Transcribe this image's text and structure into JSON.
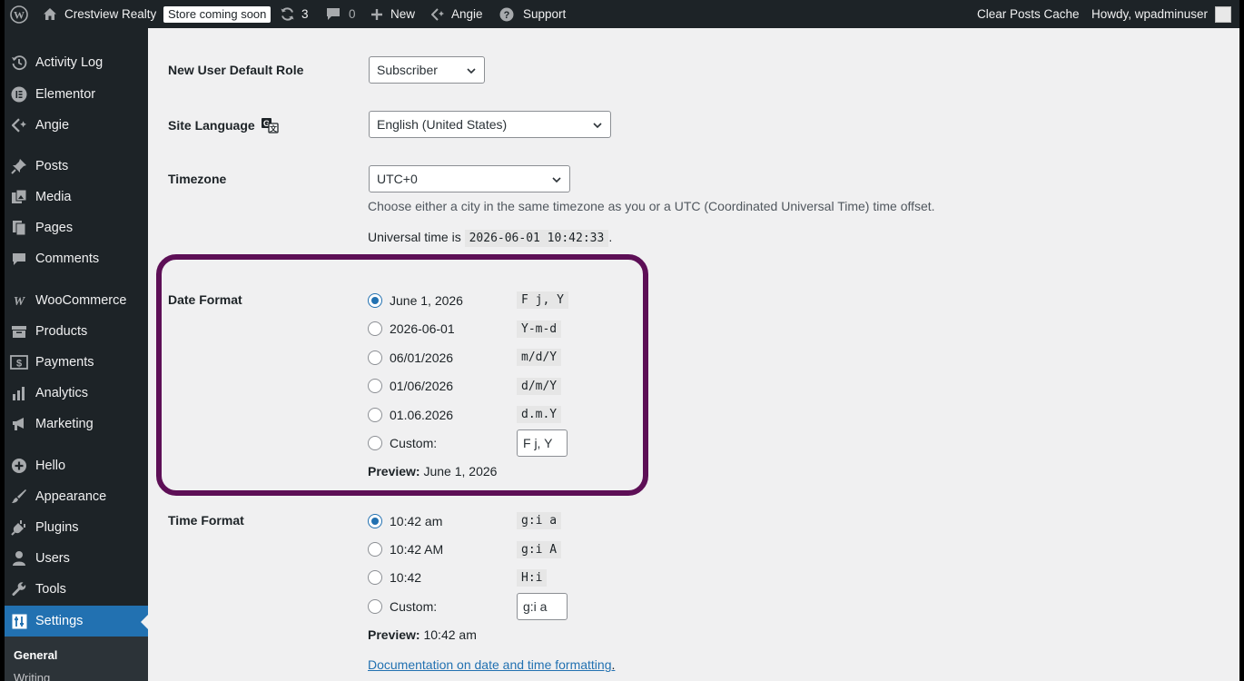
{
  "admin_bar": {
    "site_name": "Crestview Realty",
    "store_badge": "Store coming soon",
    "updates_count": "3",
    "comments_count": "0",
    "new_label": "New",
    "angie_label": "Angie",
    "support_label": "Support",
    "clear_cache": "Clear Posts Cache",
    "howdy": "Howdy, wpadminuser"
  },
  "sidebar": {
    "items": [
      {
        "label": "Activity Log",
        "icon": "history-icon"
      },
      {
        "label": "Elementor",
        "icon": "elementor-icon"
      },
      {
        "label": "Angie",
        "icon": "angie-icon"
      },
      {
        "label": "Posts",
        "icon": "pin-icon"
      },
      {
        "label": "Media",
        "icon": "media-icon"
      },
      {
        "label": "Pages",
        "icon": "pages-icon"
      },
      {
        "label": "Comments",
        "icon": "comment-icon"
      },
      {
        "label": "WooCommerce",
        "icon": "woo-icon"
      },
      {
        "label": "Products",
        "icon": "products-icon"
      },
      {
        "label": "Payments",
        "icon": "payments-icon"
      },
      {
        "label": "Analytics",
        "icon": "analytics-icon"
      },
      {
        "label": "Marketing",
        "icon": "megaphone-icon"
      },
      {
        "label": "Hello",
        "icon": "plus-circle-icon"
      },
      {
        "label": "Appearance",
        "icon": "brush-icon"
      },
      {
        "label": "Plugins",
        "icon": "plug-icon"
      },
      {
        "label": "Users",
        "icon": "user-icon"
      },
      {
        "label": "Tools",
        "icon": "wrench-icon"
      },
      {
        "label": "Settings",
        "icon": "settings-icon"
      }
    ],
    "submenu": {
      "general": "General",
      "writing": "Writing"
    }
  },
  "form": {
    "default_role": {
      "label": "New User Default Role",
      "value": "Subscriber"
    },
    "site_language": {
      "label": "Site Language",
      "value": "English (United States)"
    },
    "timezone": {
      "label": "Timezone",
      "value": "UTC+0",
      "description": "Choose either a city in the same timezone as you or a UTC (Coordinated Universal Time) time offset.",
      "universal_prefix": "Universal time is",
      "universal_time": "2026-06-01 10:42:33",
      "universal_suffix": "."
    },
    "date_format": {
      "label": "Date Format",
      "options": [
        {
          "label": "June 1, 2026",
          "code": "F j, Y",
          "checked": true
        },
        {
          "label": "2026-06-01",
          "code": "Y-m-d",
          "checked": false
        },
        {
          "label": "06/01/2026",
          "code": "m/d/Y",
          "checked": false
        },
        {
          "label": "01/06/2026",
          "code": "d/m/Y",
          "checked": false
        },
        {
          "label": "01.06.2026",
          "code": "d.m.Y",
          "checked": false
        }
      ],
      "custom_label": "Custom:",
      "custom_value": "F j, Y",
      "preview_label": "Preview:",
      "preview_value": "June 1, 2026"
    },
    "time_format": {
      "label": "Time Format",
      "options": [
        {
          "label": "10:42 am",
          "code": "g:i a",
          "checked": true
        },
        {
          "label": "10:42 AM",
          "code": "g:i A",
          "checked": false
        },
        {
          "label": "10:42",
          "code": "H:i",
          "checked": false
        }
      ],
      "custom_label": "Custom:",
      "custom_value": "g:i a",
      "preview_label": "Preview:",
      "preview_value": "10:42 am"
    },
    "doc_link": "Documentation on date and time formatting",
    "doc_suffix": "."
  },
  "colors": {
    "accent": "#2271b1",
    "highlight_border": "#5d0f56",
    "sidebar_bg": "#1d2327"
  }
}
